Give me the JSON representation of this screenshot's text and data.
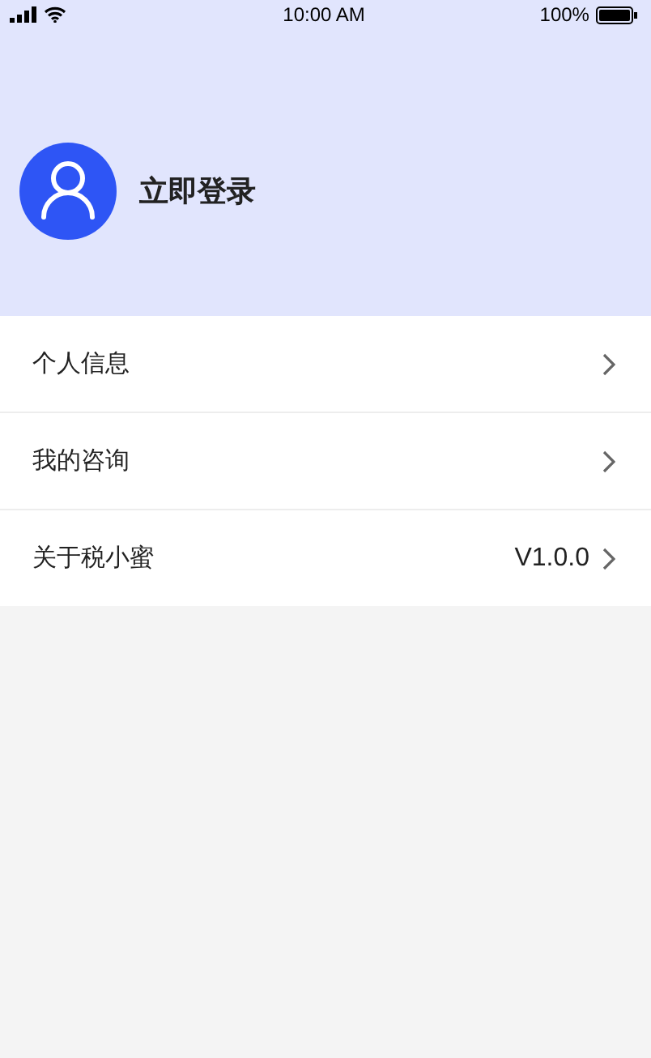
{
  "status_bar": {
    "time": "10:00 AM",
    "battery": "100%"
  },
  "profile": {
    "login_label": "立即登录"
  },
  "menu": [
    {
      "label": "个人信息"
    },
    {
      "label": "我的咨询"
    },
    {
      "label": "关于税小蜜",
      "value": "V1.0.0"
    }
  ]
}
